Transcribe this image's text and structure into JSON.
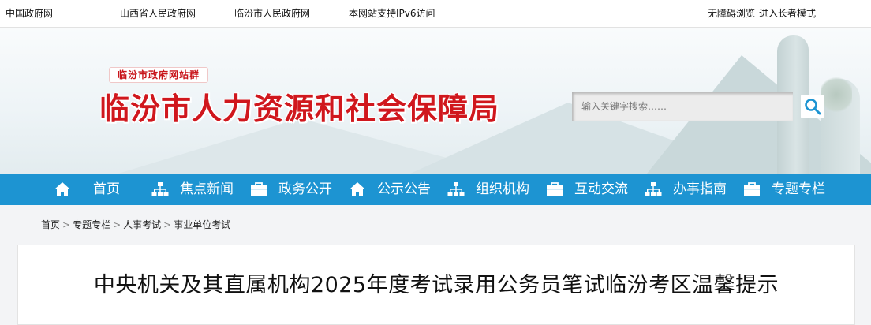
{
  "topbar": {
    "links": [
      "中国政府网",
      "山西省人民政府网",
      "临汾市人民政府网",
      "本网站支持IPv6访问"
    ],
    "accessibility": "无障碍浏览",
    "elderly_mode": "进入长者模式"
  },
  "header": {
    "group_tag": "临汾市政府网站群",
    "site_title": "临汾市人力资源和社会保障局",
    "search_placeholder": "输入关键字搜索……"
  },
  "nav": {
    "items": [
      {
        "label": "首页",
        "icon": "home-icon"
      },
      {
        "label": "焦点新闻",
        "icon": "org-chart-icon"
      },
      {
        "label": "政务公开",
        "icon": "briefcase-icon"
      },
      {
        "label": "公示公告",
        "icon": "home-icon"
      },
      {
        "label": "组织机构",
        "icon": "org-chart-icon"
      },
      {
        "label": "互动交流",
        "icon": "briefcase-icon"
      },
      {
        "label": "办事指南",
        "icon": "org-chart-icon"
      },
      {
        "label": "专题专栏",
        "icon": "briefcase-icon"
      }
    ]
  },
  "breadcrumb": [
    "首页",
    "专题专栏",
    "人事考试",
    "事业单位考试"
  ],
  "article": {
    "title": "中央机关及其直属机构2025年度考试录用公务员笔试临汾考区温馨提示"
  },
  "colors": {
    "nav_bg": "#1d94d2",
    "title_red": "#d0171d"
  }
}
